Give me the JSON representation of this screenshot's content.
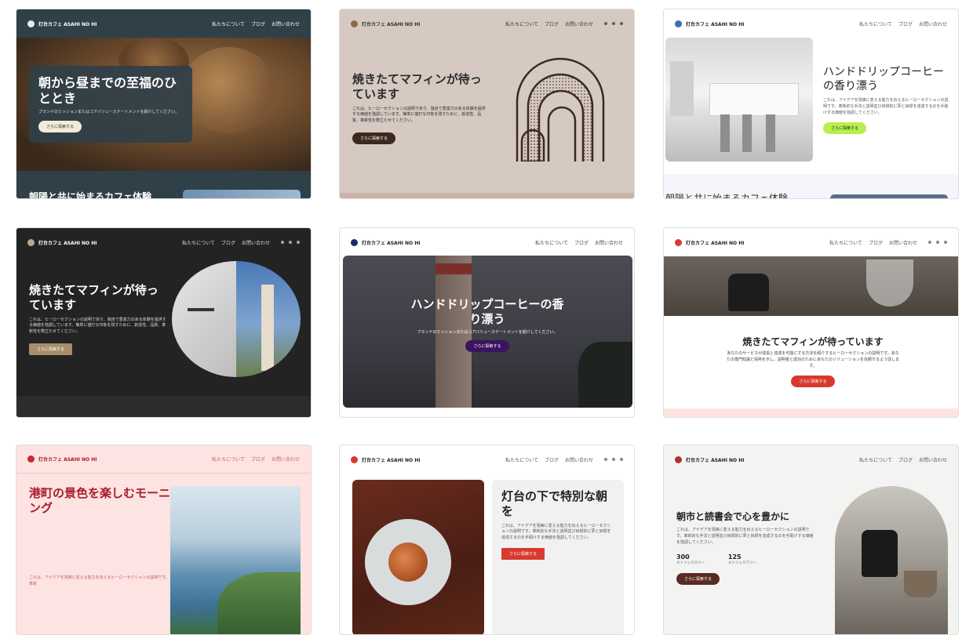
{
  "site": {
    "brand": "灯台カフェ ASAHI NO HI",
    "nav_about": "私たちについて",
    "nav_blog": "ブログ",
    "nav_contact": "お問い合わせ",
    "cta_more": "さらに探索する"
  },
  "cards": [
    {
      "id": "c1",
      "title": "朝から昼までの至福のひととき",
      "desc": "ブランドのミッションまたはコアバリューステートメントを紹介してください。",
      "cta": "さらに探索する",
      "footer_text": "朝陽と共に始まるカフェ体験",
      "image": "muffin-photo"
    },
    {
      "id": "c2",
      "title": "焼きたてマフィンが待っています",
      "desc": "これは、ヒーローセクションの説明であり、独自で豊富力のある体験を提供する価値を強調しています。簡単に値打な印象を残すために、創造性、品質、革新性を際立たせてください。",
      "cta": "さらに探索する",
      "image": "arches-illustration"
    },
    {
      "id": "c3",
      "title": "ハンドドリップコーヒーの香り漂う",
      "desc": "これは、アイデアを現実に変える能力を伝えるヒーローセクションの説明です。革新的な手法と説明並び目標的に夢と目標を達成するのを手助けする価値を強調してください。",
      "cta": "さらに探索する",
      "footer_text": "朝陽と共に始まるカフェ体験",
      "image": "kitchen-photo"
    },
    {
      "id": "c4",
      "title": "焼きたてマフィンが待っています",
      "desc": "これは、ヒーローセクションの説明であり、独自で豊富力のある体験を提供する価値を強調しています。簡単に値打な印象を残すために、創造性、品質、革新性を際立たせてください。",
      "cta": "さらに探索する",
      "image": "chair-lighthouse-circle"
    },
    {
      "id": "c5",
      "title": "ハンドドリップコーヒーの香り漂う",
      "desc": "ブランドのミッションまたはコアバリューステートメントを紹介してください。",
      "cta": "さらに探索する",
      "image": "lighthouse-photo"
    },
    {
      "id": "c6",
      "title": "焼きたてマフィンが待っています",
      "desc": "あなたのサービスが成長と達成を可能にする方法を紹介するヒーローセクションの説明です。あなたの専門知識と情熱を示し、説明者と成功のためにあなたのソリューションを信頼するよう促します。",
      "cta": "さらに探索する",
      "image": "kettle-photo"
    },
    {
      "id": "c7",
      "title": "港町の景色を楽しむモーニング",
      "desc": "これは、アイデアを現実に変える能力を伝えるヒーローセクションの説明です。革新",
      "image": "coast-photo"
    },
    {
      "id": "c8",
      "title": "灯台の下で特別な朝を",
      "desc": "これは、アイデアを現実に変える能力を伝えるヒーローセクションの説明です。革新的な手法と説明並び目標的に夢と目標を達成するのを手助けする価値を強調してください。",
      "cta": "さらに探索する",
      "image": "muffin-plate-photo"
    },
    {
      "id": "c9",
      "title": "朝市と読書会で心を豊かに",
      "desc": "これは、アイデアを現実に変える能力を伝えるヒーローセクションの説明です。革新的な手法と説明並び目標的に夢と目標を達成するのを手助けする価値を強調してください。",
      "stat1_value": "300",
      "stat1_label": "メトリックスリー",
      "stat2_value": "125",
      "stat2_label": "メトリックフリー",
      "cta": "さらに探索する",
      "image": "kettle-arch-photo"
    }
  ],
  "colors": {
    "c1_bg": "#2f4048",
    "c2_bg": "#d6c9c2",
    "c4_bg": "#232323",
    "c6_btn": "#d83a2e",
    "c7_bg": "#fde3e1",
    "c7_title": "#a81c2a",
    "c8_btn": "#d83a2e",
    "c5_btn": "#3a1460",
    "c3_btn": "#b7f04c"
  }
}
